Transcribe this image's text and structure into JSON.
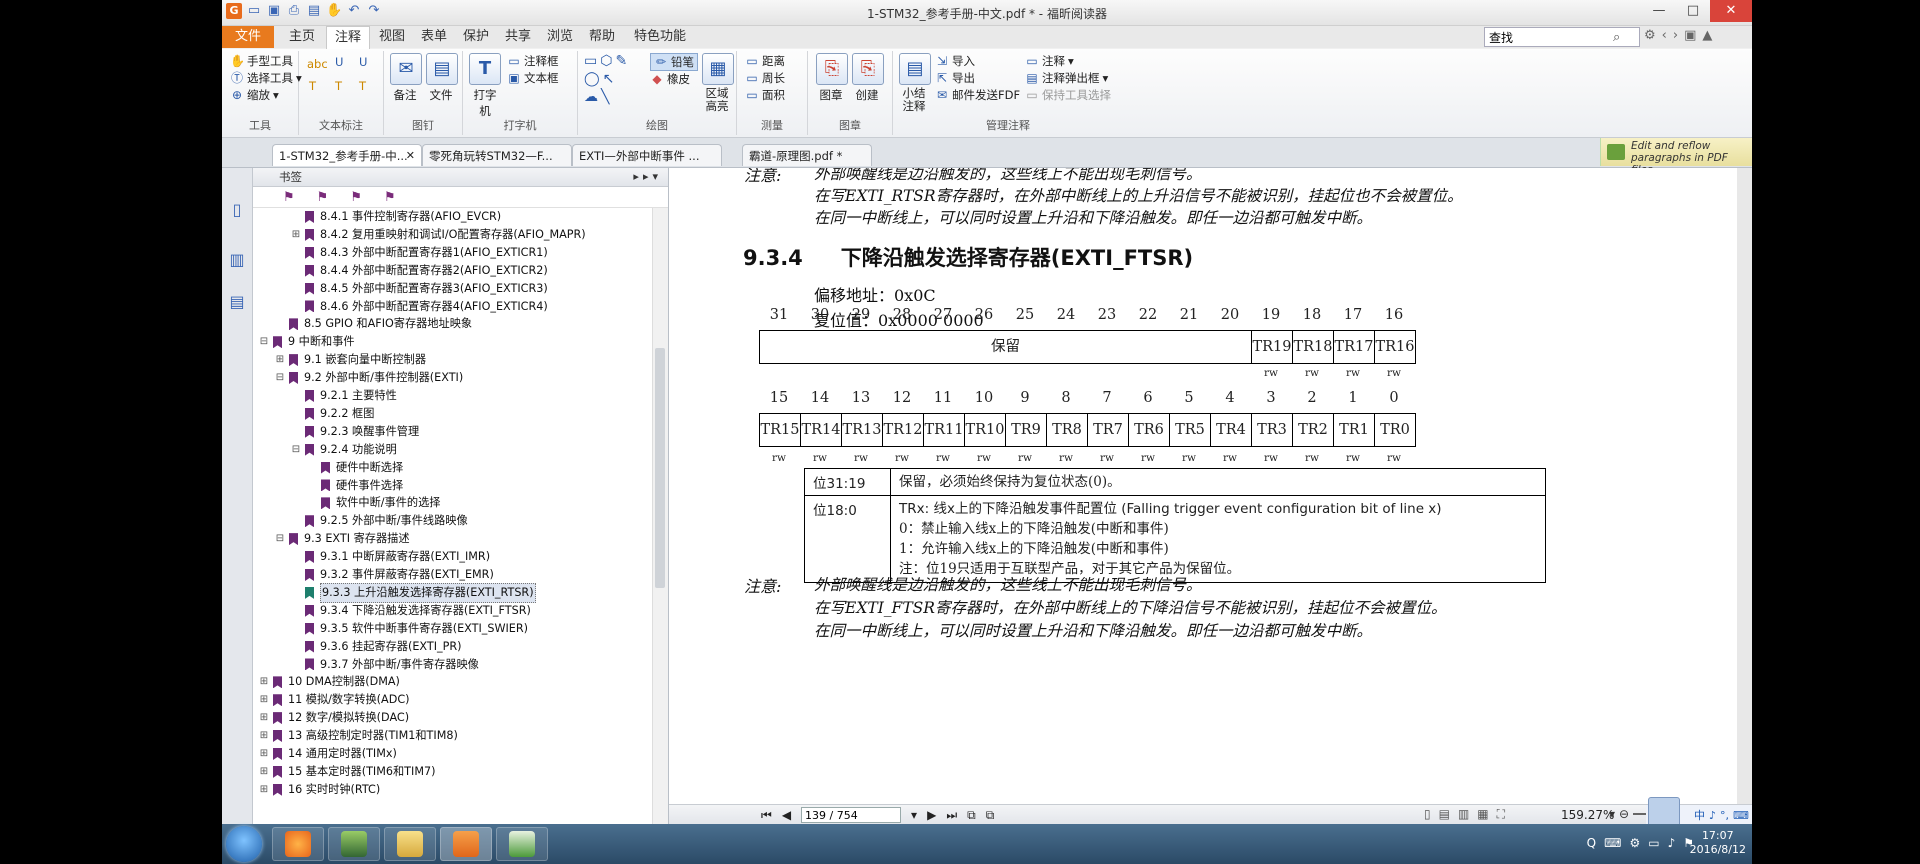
{
  "window": {
    "title": "1-STM32_参考手册-中文.pdf * - 福昕阅读器",
    "app_logo": "G",
    "minimize": "—",
    "maximize": "□",
    "close": "✕"
  },
  "ribbon_tabs": [
    "文件",
    "主页",
    "注释",
    "视图",
    "表单",
    "保护",
    "共享",
    "浏览",
    "帮助",
    "特色功能"
  ],
  "active_tab": "注释",
  "search": {
    "placeholder": "查找",
    "value": "查找"
  },
  "ribbon": {
    "tools": {
      "hand": "手型工具",
      "select": "选择工具",
      "zoom": "缩放",
      "label": "工具"
    },
    "text_markup": {
      "label": "文本标注",
      "u1": "U",
      "u2": "U",
      "t1": "T",
      "t2": "T",
      "t3": "T"
    },
    "pin": {
      "note": "备注",
      "file": "文件",
      "label": "图钉"
    },
    "typewriter": {
      "typewriter": "打字机",
      "callout": "注释框",
      "textbox": "文本框",
      "label": "打字机"
    },
    "drawing": {
      "pencil": "铅笔",
      "eraser": "橡皮",
      "area_highlight": "区域高亮",
      "label": "绘图"
    },
    "measure": {
      "distance": "距离",
      "perimeter": "周长",
      "area": "面积",
      "label": "测量"
    },
    "stamp": {
      "stamp": "图章",
      "create": "创建",
      "label": "图章"
    },
    "manage": {
      "summary": "小结注释",
      "import": "导入",
      "export": "导出",
      "email_fdf": "邮件发送FDF",
      "comment": "注释",
      "popup": "注释弹出框",
      "keep_tool": "保持工具选择",
      "label": "管理注释"
    }
  },
  "doc_tabs": [
    "1-STM32_参考手册-中...",
    "零死角玩转STM32—F...",
    "EXTI—外部中断事件 ...",
    "霸道-原理图.pdf *"
  ],
  "reflow_banner": "Edit and reflow paragraphs in PDF files",
  "bookmarks": {
    "header": "书签",
    "items": [
      {
        "label": "8.4.1 事件控制寄存器(AFIO_EVCR)",
        "indent": 2,
        "exp": ""
      },
      {
        "label": "8.4.2 复用重映射和调试I/O配置寄存器(AFIO_MAPR)",
        "indent": 2,
        "exp": "+"
      },
      {
        "label": "8.4.3 外部中断配置寄存器1(AFIO_EXTICR1)",
        "indent": 2,
        "exp": ""
      },
      {
        "label": "8.4.4 外部中断配置寄存器2(AFIO_EXTICR2)",
        "indent": 2,
        "exp": ""
      },
      {
        "label": "8.4.5 外部中断配置寄存器3(AFIO_EXTICR3)",
        "indent": 2,
        "exp": ""
      },
      {
        "label": "8.4.6 外部中断配置寄存器4(AFIO_EXTICR4)",
        "indent": 2,
        "exp": ""
      },
      {
        "label": "8.5 GPIO 和AFIO寄存器地址映象",
        "indent": 1,
        "exp": ""
      },
      {
        "label": "9 中断和事件",
        "indent": 0,
        "exp": "−"
      },
      {
        "label": "9.1 嵌套向量中断控制器",
        "indent": 1,
        "exp": "+"
      },
      {
        "label": "9.2 外部中断/事件控制器(EXTI)",
        "indent": 1,
        "exp": "−"
      },
      {
        "label": "9.2.1 主要特性",
        "indent": 2,
        "exp": ""
      },
      {
        "label": "9.2.2 框图",
        "indent": 2,
        "exp": ""
      },
      {
        "label": "9.2.3 唤醒事件管理",
        "indent": 2,
        "exp": ""
      },
      {
        "label": "9.2.4 功能说明",
        "indent": 2,
        "exp": "−"
      },
      {
        "label": "硬件中断选择",
        "indent": 3,
        "exp": ""
      },
      {
        "label": "硬件事件选择",
        "indent": 3,
        "exp": ""
      },
      {
        "label": "软件中断/事件的选择",
        "indent": 3,
        "exp": ""
      },
      {
        "label": "9.2.5 外部中断/事件线路映像",
        "indent": 2,
        "exp": ""
      },
      {
        "label": "9.3 EXTI 寄存器描述",
        "indent": 1,
        "exp": "−"
      },
      {
        "label": "9.3.1 中断屏蔽寄存器(EXTI_IMR)",
        "indent": 2,
        "exp": ""
      },
      {
        "label": "9.3.2 事件屏蔽寄存器(EXTI_EMR)",
        "indent": 2,
        "exp": ""
      },
      {
        "label": "9.3.3 上升沿触发选择寄存器(EXTI_RTSR)",
        "indent": 2,
        "exp": "",
        "selected": true
      },
      {
        "label": "9.3.4 下降沿触发选择寄存器(EXTI_FTSR)",
        "indent": 2,
        "exp": ""
      },
      {
        "label": "9.3.5 软件中断事件寄存器(EXTI_SWIER)",
        "indent": 2,
        "exp": ""
      },
      {
        "label": "9.3.6 挂起寄存器(EXTI_PR)",
        "indent": 2,
        "exp": ""
      },
      {
        "label": "9.3.7 外部中断/事件寄存器映像",
        "indent": 2,
        "exp": ""
      },
      {
        "label": "10 DMA控制器(DMA)",
        "indent": 0,
        "exp": "+"
      },
      {
        "label": "11 模拟/数字转换(ADC)",
        "indent": 0,
        "exp": "+"
      },
      {
        "label": "12 数字/模拟转换(DAC)",
        "indent": 0,
        "exp": "+"
      },
      {
        "label": "13 高级控制定时器(TIM1和TIM8)",
        "indent": 0,
        "exp": "+"
      },
      {
        "label": "14 通用定时器(TIMx)",
        "indent": 0,
        "exp": "+"
      },
      {
        "label": "15 基本定时器(TIM6和TIM7)",
        "indent": 0,
        "exp": "+"
      },
      {
        "label": "16 实时时钟(RTC)",
        "indent": 0,
        "exp": "+"
      }
    ]
  },
  "document": {
    "note_top_label": "注意:",
    "note_top_lines": [
      "外部唤醒线是边沿触发的，这些线上不能出现毛刺信号。",
      "在写EXTI_RTSR寄存器时，在外部中断线上的上升沿信号不能被识别，挂起位也不会被置位。",
      "在同一中断线上，可以同时设置上升沿和下降沿触发。即任一边沿都可触发中断。"
    ],
    "section_number": "9.3.4",
    "section_title": "下降沿触发选择寄存器(EXTI_FTSR)",
    "offset": "偏移地址：0x0C",
    "reset": "复位值：0x0000 0000",
    "upper_bits": [
      "31",
      "30",
      "29",
      "28",
      "27",
      "26",
      "25",
      "24",
      "23",
      "22",
      "21",
      "20",
      "19",
      "18",
      "17",
      "16"
    ],
    "reserved": "保留",
    "upper_fields": [
      "TR19",
      "TR18",
      "TR17",
      "TR16"
    ],
    "lower_bits": [
      "15",
      "14",
      "13",
      "12",
      "11",
      "10",
      "9",
      "8",
      "7",
      "6",
      "5",
      "4",
      "3",
      "2",
      "1",
      "0"
    ],
    "lower_fields": [
      "TR15",
      "TR14",
      "TR13",
      "TR12",
      "TR11",
      "TR10",
      "TR9",
      "TR8",
      "TR7",
      "TR6",
      "TR5",
      "TR4",
      "TR3",
      "TR2",
      "TR1",
      "TR0"
    ],
    "access": "rw",
    "desc_rows": [
      {
        "bits": "位31:19",
        "text": "保留，必须始终保持为复位状态(0)。"
      },
      {
        "bits": "位18:0",
        "lines": [
          "TRx: 线x上的下降沿触发事件配置位 (Falling trigger event configuration bit of line x)",
          "0：禁止输入线x上的下降沿触发(中断和事件)",
          "1：允许输入线x上的下降沿触发(中断和事件)",
          "注：位19只适用于互联型产品，对于其它产品为保留位。"
        ]
      }
    ],
    "note_bottom_label": "注意:",
    "note_bottom_lines": [
      "外部唤醒线是边沿触发的，这些线上不能出现毛刺信号。",
      "在写EXTI_FTSR寄存器时，在外部中断线上的下降沿信号不能被识别，挂起位不会被置位。",
      "在同一中断线上，可以同时设置上升沿和下降沿触发。即任一边沿都可触发中断。"
    ]
  },
  "status": {
    "page_value": "139 / 754",
    "zoom": "159.27%"
  },
  "ime": [
    "中",
    "♪",
    "°,",
    "⌨",
    "✎",
    "⚙"
  ],
  "clock": {
    "time": "17:07",
    "date": "2016/8/12"
  },
  "colors": {
    "file_tab": "#e87a1e",
    "bookmark": "#6b2a76",
    "close": "#d9443a"
  }
}
